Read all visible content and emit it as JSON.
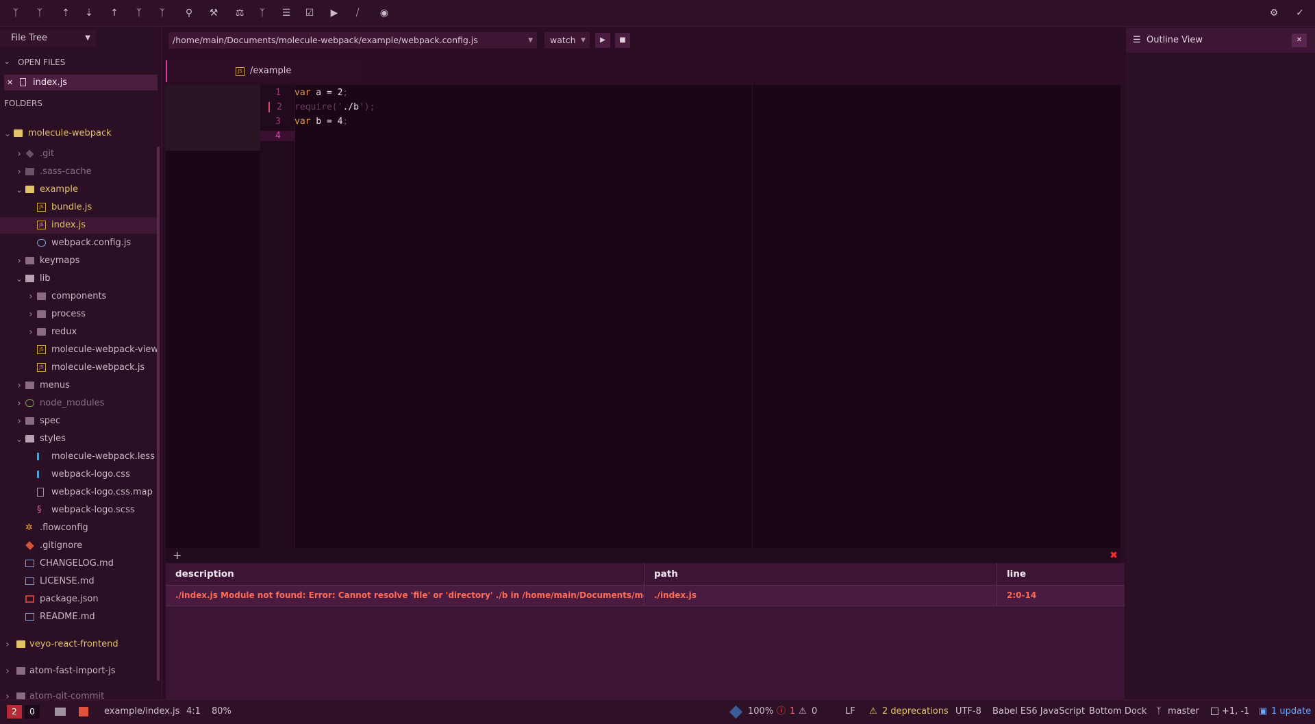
{
  "toolbar": {
    "buttons": [
      "git-commit-icon",
      "git-branch-icon",
      "git-pull-icon",
      "git-fetch-icon",
      "git-push-icon",
      "git-merge-icon",
      "git-stash-icon",
      "pin-icon",
      "tools-icon",
      "scale-icon",
      "fork-icon",
      "list-icon",
      "checklist-icon",
      "play-icon",
      "split-icon",
      "eye-icon"
    ],
    "right_buttons": [
      "gear-icon",
      "check-circle-icon"
    ]
  },
  "left_panel": {
    "selector_label": "File Tree",
    "open_files_header": "OPEN FILES",
    "open_files": [
      {
        "label": "index.js"
      }
    ],
    "folders_header": "FOLDERS",
    "tree": [
      {
        "label": "molecule-webpack",
        "depth": 0,
        "type": "project",
        "expanded": true,
        "tone": "yellow"
      },
      {
        "label": ".git",
        "depth": 1,
        "type": "git",
        "expanded": false,
        "tone": "dim"
      },
      {
        "label": ".sass-cache",
        "depth": 1,
        "type": "folder",
        "expanded": false,
        "tone": "dim"
      },
      {
        "label": "example",
        "depth": 1,
        "type": "folder",
        "expanded": true,
        "tone": "yellow"
      },
      {
        "label": "bundle.js",
        "depth": 2,
        "type": "js",
        "tone": "yellow"
      },
      {
        "label": "index.js",
        "depth": 2,
        "type": "js",
        "tone": "yellow",
        "active": true
      },
      {
        "label": "webpack.config.js",
        "depth": 2,
        "type": "config",
        "tone": "norm"
      },
      {
        "label": "keymaps",
        "depth": 1,
        "type": "folder",
        "expanded": false,
        "tone": "norm"
      },
      {
        "label": "lib",
        "depth": 1,
        "type": "folder",
        "expanded": true,
        "tone": "norm"
      },
      {
        "label": "components",
        "depth": 2,
        "type": "folder",
        "expanded": false,
        "tone": "norm"
      },
      {
        "label": "process",
        "depth": 2,
        "type": "folder",
        "expanded": false,
        "tone": "norm"
      },
      {
        "label": "redux",
        "depth": 2,
        "type": "folder",
        "expanded": false,
        "tone": "norm"
      },
      {
        "label": "molecule-webpack-view.j",
        "depth": 2,
        "type": "js",
        "tone": "norm"
      },
      {
        "label": "molecule-webpack.js",
        "depth": 2,
        "type": "js",
        "tone": "norm"
      },
      {
        "label": "menus",
        "depth": 1,
        "type": "folder",
        "expanded": false,
        "tone": "norm"
      },
      {
        "label": "node_modules",
        "depth": 1,
        "type": "node",
        "expanded": false,
        "tone": "dim"
      },
      {
        "label": "spec",
        "depth": 1,
        "type": "folder",
        "expanded": false,
        "tone": "norm"
      },
      {
        "label": "styles",
        "depth": 1,
        "type": "folder",
        "expanded": true,
        "tone": "norm"
      },
      {
        "label": "molecule-webpack.less",
        "depth": 2,
        "type": "css",
        "tone": "norm"
      },
      {
        "label": "webpack-logo.css",
        "depth": 2,
        "type": "css",
        "tone": "norm"
      },
      {
        "label": "webpack-logo.css.map",
        "depth": 2,
        "type": "plain",
        "tone": "norm"
      },
      {
        "label": "webpack-logo.scss",
        "depth": 2,
        "type": "sass",
        "tone": "norm"
      },
      {
        "label": ".flowconfig",
        "depth": 1,
        "type": "flow",
        "tone": "norm"
      },
      {
        "label": ".gitignore",
        "depth": 1,
        "type": "gitfile",
        "tone": "norm"
      },
      {
        "label": "CHANGELOG.md",
        "depth": 1,
        "type": "md",
        "tone": "norm"
      },
      {
        "label": "LICENSE.md",
        "depth": 1,
        "type": "md",
        "tone": "norm"
      },
      {
        "label": "package.json",
        "depth": 1,
        "type": "npm",
        "tone": "norm"
      },
      {
        "label": "README.md",
        "depth": 1,
        "type": "md",
        "tone": "norm"
      }
    ],
    "projects": [
      {
        "label": "veyo-react-frontend",
        "tone": "yellow"
      },
      {
        "label": "atom-fast-import-js",
        "tone": "norm"
      },
      {
        "label": "atom-git-commit",
        "tone": "dim"
      }
    ]
  },
  "editor": {
    "config_path": "/home/main/Documents/molecule-webpack/example/webpack.config.js",
    "watch_option": "watch",
    "tab_title": "/example",
    "lines": [
      {
        "num": "1",
        "parts": [
          [
            "kw",
            "var"
          ],
          [
            "num",
            " a = 2"
          ],
          [
            "cm",
            ";"
          ]
        ]
      },
      {
        "num": "2",
        "parts": [
          [
            "cm",
            "require('"
          ],
          [
            "num",
            "./b"
          ],
          [
            "cm",
            "');"
          ]
        ]
      },
      {
        "num": "3",
        "parts": [
          [
            "kw",
            "var"
          ],
          [
            "num",
            " b = 4"
          ],
          [
            "cm",
            ";"
          ]
        ]
      },
      {
        "num": "4",
        "parts": []
      }
    ]
  },
  "lint": {
    "headers": {
      "description": "description",
      "path": "path",
      "line": "line"
    },
    "rows": [
      {
        "description": "./index.js Module not found: Error: Cannot resolve 'file' or 'directory' ./b in /home/main/Documents/molecule-webpack/example",
        "path": "./index.js",
        "line": "2:0-14"
      }
    ]
  },
  "right_panel": {
    "title": "Outline View"
  },
  "status": {
    "errors": "2",
    "warnings": "0",
    "file": "example/index.js",
    "cursor": "4:1",
    "zoom": "80%",
    "coverage": "100%",
    "lint_errors": "1",
    "lint_warnings": "0",
    "line_ending": "LF",
    "deprecations": "2 deprecations",
    "encoding": "UTF-8",
    "grammar": "Babel ES6 JavaScript",
    "dock": "Bottom Dock",
    "branch": "master",
    "diff": "+1, -1",
    "updates": "1 update"
  },
  "colors": {
    "accent": "#d63f9c",
    "error": "#ff6a52",
    "folder_highlight": "#e2c36a",
    "update": "#6aa7ff"
  }
}
